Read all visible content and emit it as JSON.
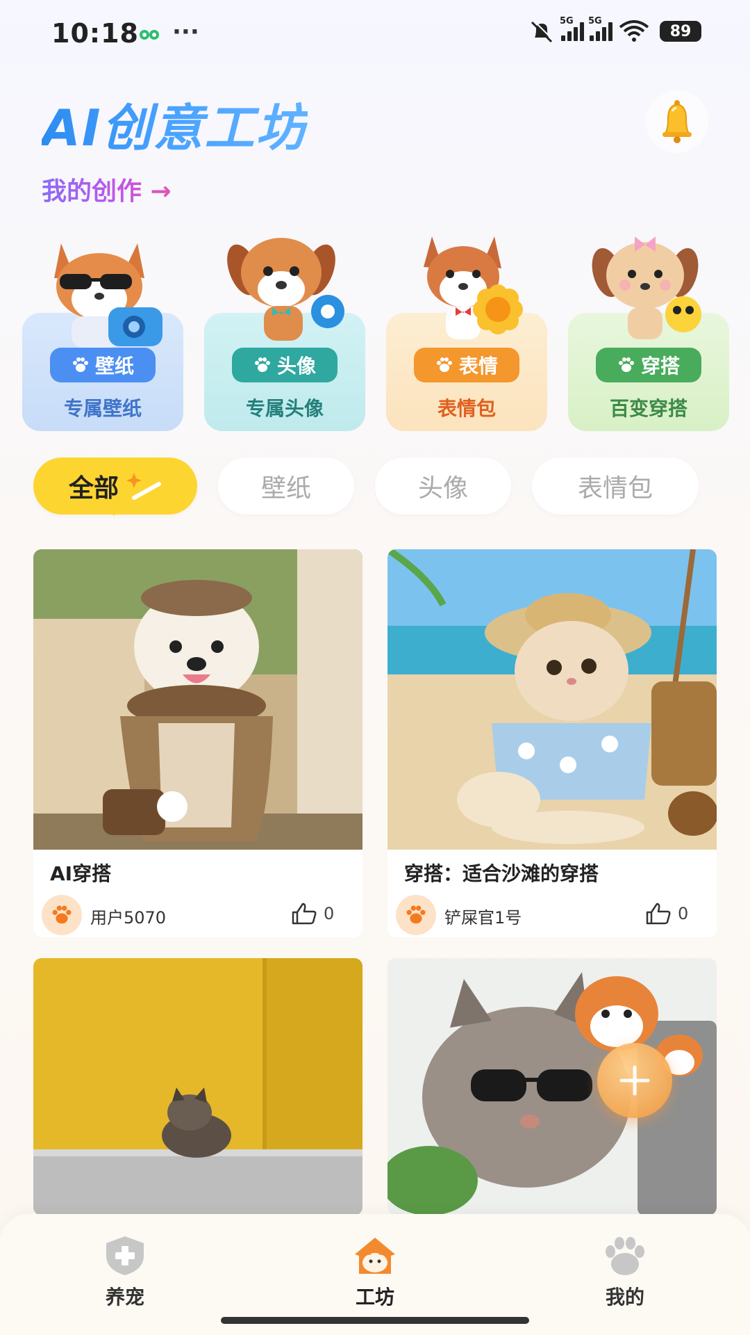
{
  "status_bar": {
    "time": "10:18",
    "dots": "···",
    "network_1": "5G",
    "network_2": "5G",
    "battery": "89"
  },
  "header": {
    "title": "AI创意工坊",
    "my_creation": "我的创作 →"
  },
  "categories": [
    {
      "tag": "壁纸",
      "label": "专属壁纸",
      "color": "#4c8ff2",
      "label_color": "#3f74c9",
      "bg": "#cfe2fb"
    },
    {
      "tag": "头像",
      "label": "专属头像",
      "color": "#2fa8a0",
      "label_color": "#24807c",
      "bg": "#c6eef0"
    },
    {
      "tag": "表情",
      "label": "表情包",
      "color": "#f4972d",
      "label_color": "#e0601f",
      "bg": "#fde9c7"
    },
    {
      "tag": "穿搭",
      "label": "百变穿搭",
      "color": "#49ac5c",
      "label_color": "#3c8a47",
      "bg": "#e0f3d2"
    }
  ],
  "filters": [
    "全部",
    "壁纸",
    "头像",
    "表情包"
  ],
  "feed": [
    {
      "title": "AI穿搭",
      "user": "用户5070",
      "likes": "0"
    },
    {
      "title": "穿搭：适合沙滩的穿搭",
      "user": "铲屎官1号",
      "likes": "0"
    }
  ],
  "bottom_nav": [
    {
      "label": "养宠"
    },
    {
      "label": "工坊"
    },
    {
      "label": "我的"
    }
  ],
  "colors": {
    "accent_yellow": "#fdd530",
    "title_blue": "#2d8cf0",
    "fab_orange": "#f39a3f"
  }
}
